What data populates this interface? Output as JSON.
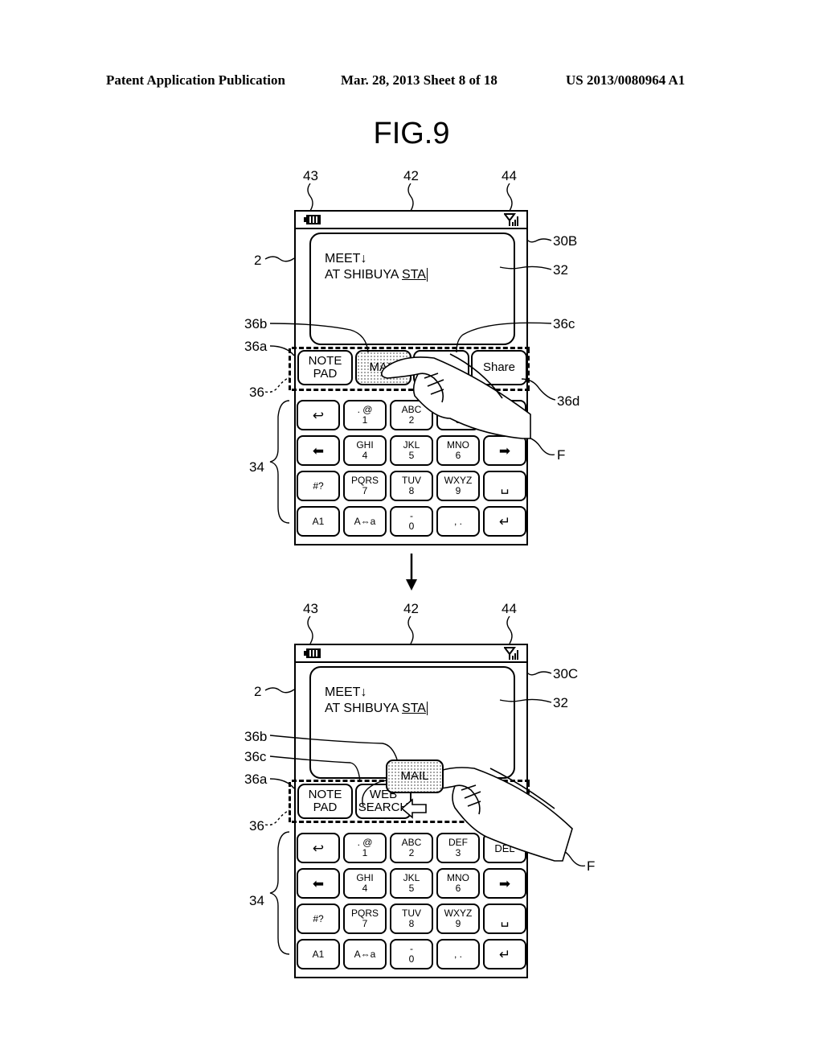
{
  "header": {
    "left": "Patent Application Publication",
    "center": "Mar. 28, 2013  Sheet 8 of 18",
    "right": "US 2013/0080964 A1"
  },
  "figure_title": "FIG.9",
  "screens": [
    {
      "id": "30B",
      "refs": {
        "battery": "43",
        "status_bar": "42",
        "signal": "44",
        "screen": "30B",
        "device": "2",
        "text_area": "32",
        "func_b": "36b",
        "func_c": "36c",
        "func_a": "36a",
        "func_row": "36",
        "func_d": "36d",
        "keyboard": "34",
        "finger": "F"
      },
      "text_line1": "MEET↓",
      "text_line2_prefix": "AT SHIBUYA ",
      "text_line2_underlined": "STA",
      "function_keys": [
        {
          "line1": "NOTE",
          "line2": "PAD"
        },
        {
          "line1": "MAIL",
          "line2": "",
          "selected": true
        },
        {
          "line1": "",
          "line2": ""
        },
        {
          "line1": "Share",
          "line2": ""
        }
      ]
    },
    {
      "id": "30C",
      "refs": {
        "battery": "43",
        "status_bar": "42",
        "signal": "44",
        "screen": "30C",
        "device": "2",
        "text_area": "32",
        "func_b": "36b",
        "func_c": "36c",
        "func_a": "36a",
        "func_row": "36",
        "keyboard": "34",
        "finger": "F"
      },
      "text_line1": "MEET↓",
      "text_line2_prefix": "AT SHIBUYA ",
      "text_line2_underlined": "STA",
      "function_keys": [
        {
          "line1": "NOTE",
          "line2": "PAD"
        },
        {
          "line1": "WEB",
          "line2": "SEARCH"
        },
        {
          "line1": "MAIL",
          "line2": "",
          "selected": true,
          "dragging": true
        }
      ]
    }
  ],
  "keyboard": {
    "rows": [
      [
        {
          "top": "↩",
          "bottom": "",
          "icon": "back-icon"
        },
        {
          "top": ". @",
          "bottom": "1"
        },
        {
          "top": "ABC",
          "bottom": "2"
        },
        {
          "top": "DEF",
          "bottom": "3"
        },
        {
          "top": "",
          "bottom": "DEL",
          "icon": "delete-icon"
        }
      ],
      [
        {
          "top": "⬅",
          "bottom": "",
          "icon": "left-arrow-icon"
        },
        {
          "top": "GHI",
          "bottom": "4"
        },
        {
          "top": "JKL",
          "bottom": "5"
        },
        {
          "top": "MNO",
          "bottom": "6"
        },
        {
          "top": "➡",
          "bottom": "",
          "icon": "right-arrow-icon"
        }
      ],
      [
        {
          "top": "#?",
          "bottom": ""
        },
        {
          "top": "PQRS",
          "bottom": "7"
        },
        {
          "top": "TUV",
          "bottom": "8"
        },
        {
          "top": "WXYZ",
          "bottom": "9"
        },
        {
          "top": "␣",
          "bottom": "",
          "icon": "space-icon"
        }
      ],
      [
        {
          "top": "A1",
          "bottom": ""
        },
        {
          "top": "A⇔a",
          "bottom": ""
        },
        {
          "top": "-",
          "bottom": "0"
        },
        {
          "top": ", .",
          "bottom": ""
        },
        {
          "top": "↵",
          "bottom": "",
          "icon": "enter-icon"
        }
      ]
    ]
  }
}
